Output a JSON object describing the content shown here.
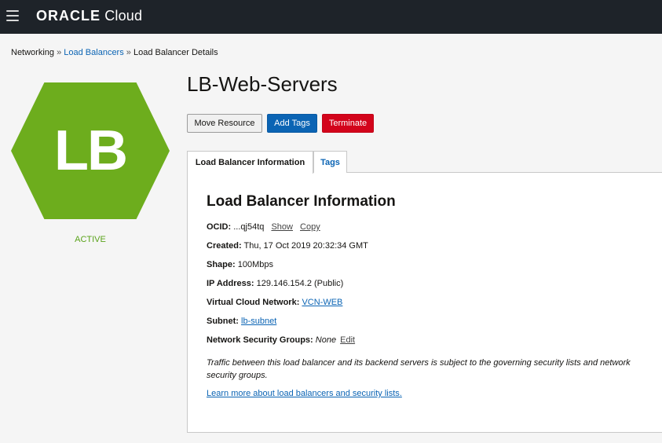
{
  "header": {
    "logo_oracle": "ORACLE",
    "logo_cloud": "Cloud"
  },
  "breadcrumb": {
    "item1": "Networking",
    "sep": "»",
    "item2": "Load Balancers",
    "item3": "Load Balancer Details"
  },
  "resource": {
    "icon_text": "LB",
    "status": "ACTIVE",
    "title": "LB-Web-Servers"
  },
  "actions": {
    "move": "Move Resource",
    "add_tags": "Add Tags",
    "terminate": "Terminate"
  },
  "tabs": [
    {
      "label": "Load Balancer Information"
    },
    {
      "label": "Tags"
    }
  ],
  "info": {
    "heading": "Load Balancer Information",
    "ocid_label": "OCID:",
    "ocid_value": "...qj54tq",
    "show": "Show",
    "copy": "Copy",
    "created_label": "Created:",
    "created_value": "Thu, 17 Oct 2019 20:32:34 GMT",
    "shape_label": "Shape:",
    "shape_value": "100Mbps",
    "ip_label": "IP Address:",
    "ip_value": "129.146.154.2 (Public)",
    "vcn_label": "Virtual Cloud Network:",
    "vcn_value": "VCN-WEB",
    "subnet_label": "Subnet:",
    "subnet_value": "lb-subnet",
    "nsg_label": "Network Security Groups:",
    "nsg_value": "None",
    "nsg_edit": "Edit",
    "note": "Traffic between this load balancer and its backend servers is subject to the governing security lists and network security groups.",
    "learn_more": "Learn more about load balancers and security lists."
  },
  "colors": {
    "topbar": "#1e2329",
    "accent_blue": "#0b64b4",
    "terminate_red": "#d3041b",
    "status_green": "#6dad1d"
  }
}
